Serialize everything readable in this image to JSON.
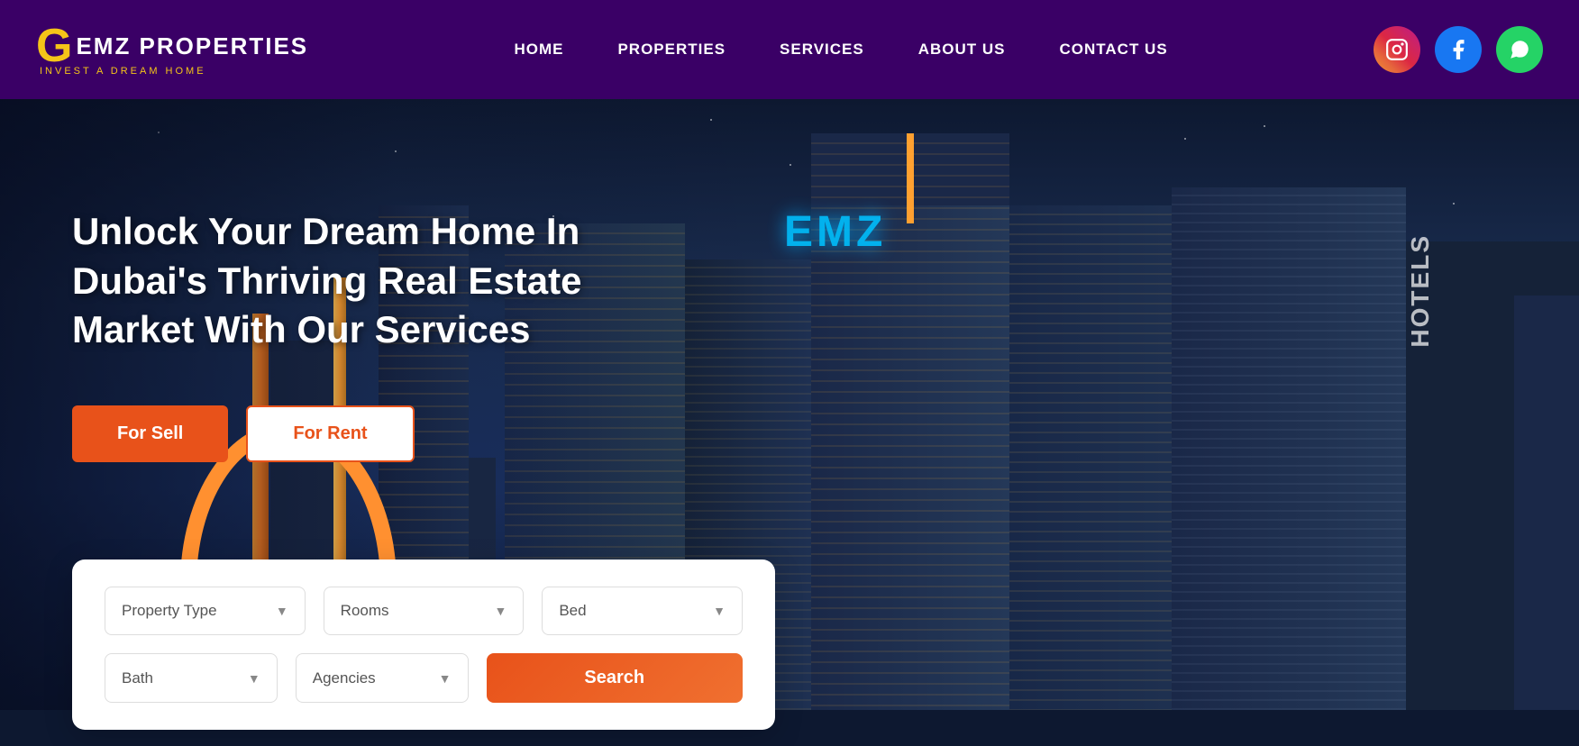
{
  "logo": {
    "g_letter": "G",
    "brand_name": "EMZ PROPERTIES",
    "tagline": "INVEST A DREAM HOME"
  },
  "nav": {
    "items": [
      {
        "label": "HOME",
        "id": "home"
      },
      {
        "label": "PROPERTIES",
        "id": "properties"
      },
      {
        "label": "SERVICES",
        "id": "services"
      },
      {
        "label": "ABOUT US",
        "id": "about"
      },
      {
        "label": "CONTACT US",
        "id": "contact"
      }
    ]
  },
  "social": {
    "instagram_label": "Instagram",
    "facebook_label": "f",
    "whatsapp_label": "W"
  },
  "hero": {
    "title": "Unlock Your Dream Home In Dubai's Thriving Real Estate Market With Our Services"
  },
  "buttons": {
    "for_sell": "For Sell",
    "for_rent": "For Rent"
  },
  "search": {
    "property_type_label": "Property Type",
    "rooms_label": "Rooms",
    "bed_label": "Bed",
    "bath_label": "Bath",
    "agencies_label": "Agencies",
    "search_btn": "Search"
  }
}
